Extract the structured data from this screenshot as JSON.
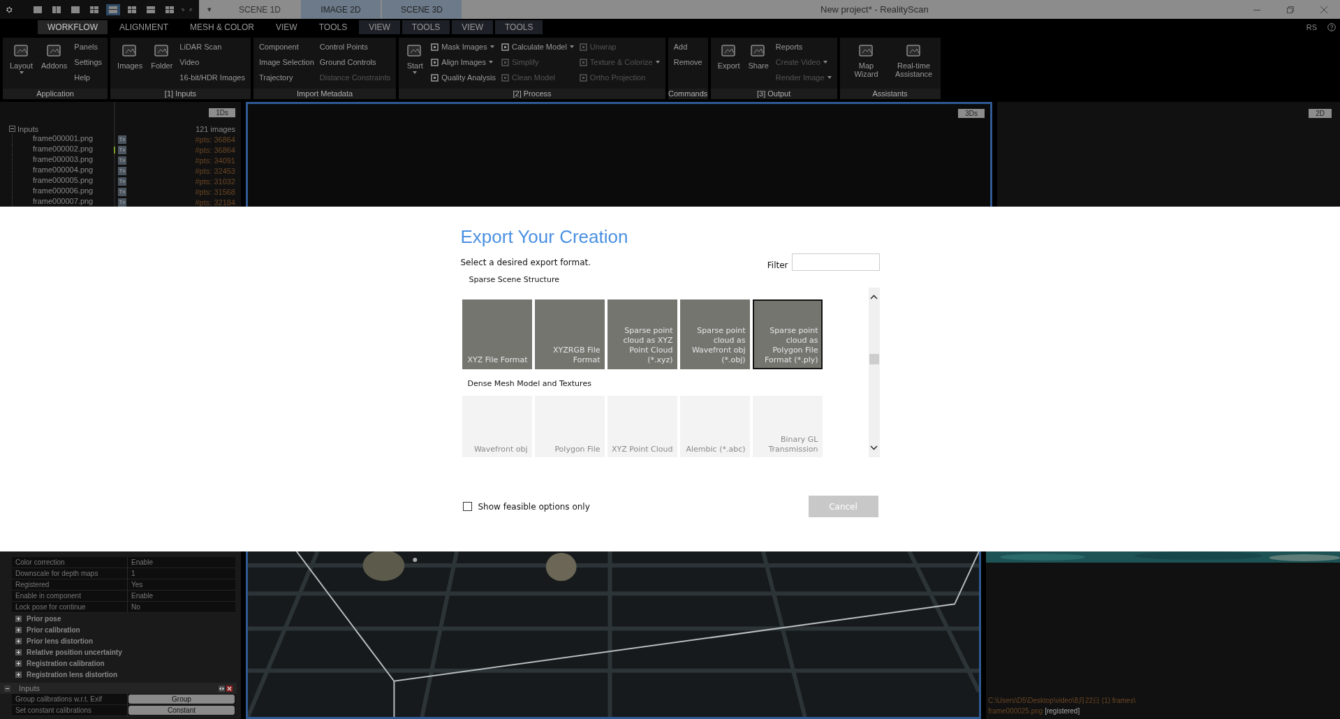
{
  "window": {
    "title": "New project* - RealityScan"
  },
  "quick_layouts": [
    {
      "selected": false
    },
    {
      "selected": false
    },
    {
      "selected": false
    },
    {
      "selected": false
    },
    {
      "selected": true
    },
    {
      "selected": false
    },
    {
      "selected": false
    },
    {
      "selected": false
    }
  ],
  "quick_menu": "▾",
  "layout_tabs": [
    {
      "label": "SCENE 1D",
      "selected": false
    },
    {
      "label": "IMAGE 2D",
      "selected": true
    },
    {
      "label": "SCENE 3D",
      "selected": true
    }
  ],
  "ribbon_tabs": [
    {
      "label": "WORKFLOW",
      "kind": "main",
      "selected": true
    },
    {
      "label": "ALIGNMENT",
      "kind": "main",
      "selected": false
    },
    {
      "label": "MESH & COLOR",
      "kind": "main",
      "selected": false
    },
    {
      "label": "VIEW",
      "kind": "main",
      "selected": false
    },
    {
      "label": "TOOLS",
      "kind": "main",
      "selected": false
    },
    {
      "label": "VIEW",
      "kind": "context",
      "selected": false
    },
    {
      "label": "TOOLS",
      "kind": "context",
      "selected": false
    },
    {
      "label": "VIEW",
      "kind": "context",
      "selected": false
    },
    {
      "label": "TOOLS",
      "kind": "context",
      "selected": false
    }
  ],
  "account": "RS",
  "ribbon_groups": [
    {
      "label": "Application",
      "items": [
        {
          "kind": "large",
          "label": "Layout",
          "disabled": false,
          "dropdown": true
        },
        {
          "kind": "large",
          "label": "Addons",
          "disabled": false,
          "dropdown": false
        },
        {
          "kind": "column",
          "items": [
            {
              "kind": "small",
              "label": "Panels",
              "disabled": false,
              "dropdown": false
            },
            {
              "kind": "small",
              "label": "Settings",
              "disabled": false,
              "dropdown": false
            },
            {
              "kind": "small",
              "label": "Help",
              "disabled": false,
              "dropdown": false
            }
          ]
        }
      ]
    },
    {
      "label": "[1] Inputs",
      "items": [
        {
          "kind": "large",
          "label": "Images",
          "disabled": false,
          "dropdown": false
        },
        {
          "kind": "large",
          "label": "Folder",
          "disabled": false,
          "dropdown": false
        },
        {
          "kind": "column",
          "items": [
            {
              "kind": "small",
              "label": "LiDAR Scan",
              "disabled": false,
              "dropdown": false
            },
            {
              "kind": "small",
              "label": "Video",
              "disabled": false,
              "dropdown": false
            },
            {
              "kind": "small",
              "label": "16-bit/HDR Images",
              "disabled": false,
              "dropdown": false
            }
          ]
        }
      ]
    },
    {
      "label": "Import Metadata",
      "items": [
        {
          "kind": "column",
          "items": [
            {
              "kind": "small",
              "label": "Component",
              "disabled": false,
              "dropdown": false
            },
            {
              "kind": "small",
              "label": "Image Selection",
              "disabled": false,
              "dropdown": false
            },
            {
              "kind": "small",
              "label": "Trajectory",
              "disabled": false,
              "dropdown": false
            }
          ]
        },
        {
          "kind": "column",
          "items": [
            {
              "kind": "small",
              "label": "Control Points",
              "disabled": false,
              "dropdown": false
            },
            {
              "kind": "small",
              "label": "Ground Controls",
              "disabled": false,
              "dropdown": false
            },
            {
              "kind": "small",
              "label": "Distance Constraints",
              "disabled": true,
              "dropdown": false
            }
          ]
        }
      ]
    },
    {
      "label": "[2] Process",
      "items": [
        {
          "kind": "large",
          "label": "Start",
          "disabled": false,
          "dropdown": true
        },
        {
          "kind": "column",
          "items": [
            {
              "kind": "iconed",
              "label": "Mask Images",
              "disabled": false,
              "dropdown": true
            },
            {
              "kind": "iconed",
              "label": "Align Images",
              "disabled": false,
              "dropdown": true
            },
            {
              "kind": "iconed",
              "label": "Quality Analysis",
              "disabled": false,
              "dropdown": false
            }
          ]
        },
        {
          "kind": "column",
          "items": [
            {
              "kind": "iconed",
              "label": "Calculate Model",
              "disabled": false,
              "dropdown": true
            },
            {
              "kind": "iconed",
              "label": "Simplify",
              "disabled": true,
              "dropdown": false
            },
            {
              "kind": "iconed",
              "label": "Clean Model",
              "disabled": true,
              "dropdown": false
            }
          ]
        },
        {
          "kind": "column",
          "items": [
            {
              "kind": "iconed",
              "label": "Unwrap",
              "disabled": true,
              "dropdown": false
            },
            {
              "kind": "iconed",
              "label": "Texture & Colorize",
              "disabled": true,
              "dropdown": true
            },
            {
              "kind": "iconed",
              "label": "Ortho Projection",
              "disabled": true,
              "dropdown": false
            }
          ]
        }
      ]
    },
    {
      "label": "Commands",
      "items": [
        {
          "kind": "column",
          "items": [
            {
              "kind": "small",
              "label": "Add",
              "disabled": false,
              "dropdown": false
            },
            {
              "kind": "small",
              "label": "Remove",
              "disabled": false,
              "dropdown": false
            }
          ]
        }
      ]
    },
    {
      "label": "[3] Output",
      "items": [
        {
          "kind": "large",
          "label": "Export",
          "disabled": false,
          "dropdown": false
        },
        {
          "kind": "large",
          "label": "Share",
          "disabled": false,
          "dropdown": false
        },
        {
          "kind": "column",
          "items": [
            {
              "kind": "small",
              "label": "Reports",
              "disabled": false,
              "dropdown": false
            },
            {
              "kind": "small",
              "label": "Create Video",
              "disabled": true,
              "dropdown": true
            },
            {
              "kind": "small",
              "label": "Render Image",
              "disabled": true,
              "dropdown": true
            }
          ]
        }
      ]
    },
    {
      "label": "Assistants",
      "items": [
        {
          "kind": "large",
          "label": "Map Wizard",
          "disabled": false,
          "dropdown": false
        },
        {
          "kind": "large",
          "label": "Real-time Assistance",
          "disabled": false,
          "dropdown": false
        }
      ]
    }
  ],
  "inputs_panel": {
    "badge": "1Ds",
    "root": {
      "label": "Inputs",
      "expanded": true,
      "count": "121 images"
    },
    "children": [
      {
        "name": "frame000001.png",
        "tag": "Tx",
        "points": "#pts: 36864",
        "selected": false
      },
      {
        "name": "frame000002.png",
        "tag": "Tx",
        "points": "#pts: 36864",
        "selected": true
      },
      {
        "name": "frame000003.png",
        "tag": "Tx",
        "points": "#pts: 34091",
        "selected": false
      },
      {
        "name": "frame000004.png",
        "tag": "Tx",
        "points": "#pts: 32453",
        "selected": false
      },
      {
        "name": "frame000005.png",
        "tag": "Tx",
        "points": "#pts: 31032",
        "selected": false
      },
      {
        "name": "frame000006.png",
        "tag": "Tx",
        "points": "#pts: 31568",
        "selected": false
      },
      {
        "name": "frame000007.png",
        "tag": "Tx",
        "points": "#pts: 32184",
        "selected": false
      }
    ]
  },
  "viewports": [
    {
      "badge": "3Ds"
    },
    {
      "badge": "2D"
    }
  ],
  "dialog": {
    "title": "Export Your Creation",
    "subtitle": "Select a desired export format.",
    "filter": {
      "label": "Filter"
    },
    "sections": [
      {
        "title": "Sparse Scene Structure",
        "formats": [
          {
            "label": "XYZ File Format",
            "selected": false,
            "disabled": false
          },
          {
            "label": "XYZRGB File Format",
            "selected": false,
            "disabled": false
          },
          {
            "label": "Sparse point cloud as XYZ Point Cloud (*.xyz)",
            "selected": false,
            "disabled": false
          },
          {
            "label": "Sparse point cloud as Wavefront obj (*.obj)",
            "selected": false,
            "disabled": false
          },
          {
            "label": "Sparse point cloud as Polygon File Format (*.ply)",
            "selected": true,
            "disabled": false
          }
        ]
      },
      {
        "title": "Dense Mesh Model and Textures",
        "formats": [
          {
            "label": "Wavefront obj",
            "selected": false,
            "disabled": true
          },
          {
            "label": "Polygon File",
            "selected": false,
            "disabled": true
          },
          {
            "label": "XYZ Point Cloud",
            "selected": false,
            "disabled": true
          },
          {
            "label": "Alembic (*.abc)",
            "selected": false,
            "disabled": true
          },
          {
            "label": "Binary GL Transmission",
            "selected": false,
            "disabled": true
          }
        ]
      }
    ],
    "feasible_only": {
      "label": "Show feasible options only",
      "checked": false
    },
    "cancel_button": "Cancel"
  },
  "properties": [
    {
      "label": "Color correction",
      "value": "Enable"
    },
    {
      "label": "Downscale for depth maps",
      "value": "1"
    },
    {
      "label": "Registered",
      "value": "Yes"
    },
    {
      "label": "Enable in component",
      "value": "Enable"
    },
    {
      "label": "Lock pose for continue",
      "value": "No"
    }
  ],
  "property_sections": [
    {
      "label": "Prior pose",
      "expanded": false
    },
    {
      "label": "Prior calibration",
      "expanded": false
    },
    {
      "label": "Prior lens distortion",
      "expanded": false
    },
    {
      "label": "Relative position uncertainty",
      "expanded": false
    },
    {
      "label": "Registration calibration",
      "expanded": false
    },
    {
      "label": "Registration lens distortion",
      "expanded": false
    }
  ],
  "inputs_settings": {
    "title": "Inputs",
    "expanded": true,
    "rows": [
      {
        "label": "Group calibrations w.r.t. Exif",
        "button": "Group"
      },
      {
        "label": "Set constant calibrations",
        "button": "Constant"
      }
    ]
  },
  "status": {
    "path": "C:\\Users\\D5\\Desktop\\video\\8月22日 (1) frames\\",
    "file": "frame000025.png",
    "state": "[registered]"
  }
}
